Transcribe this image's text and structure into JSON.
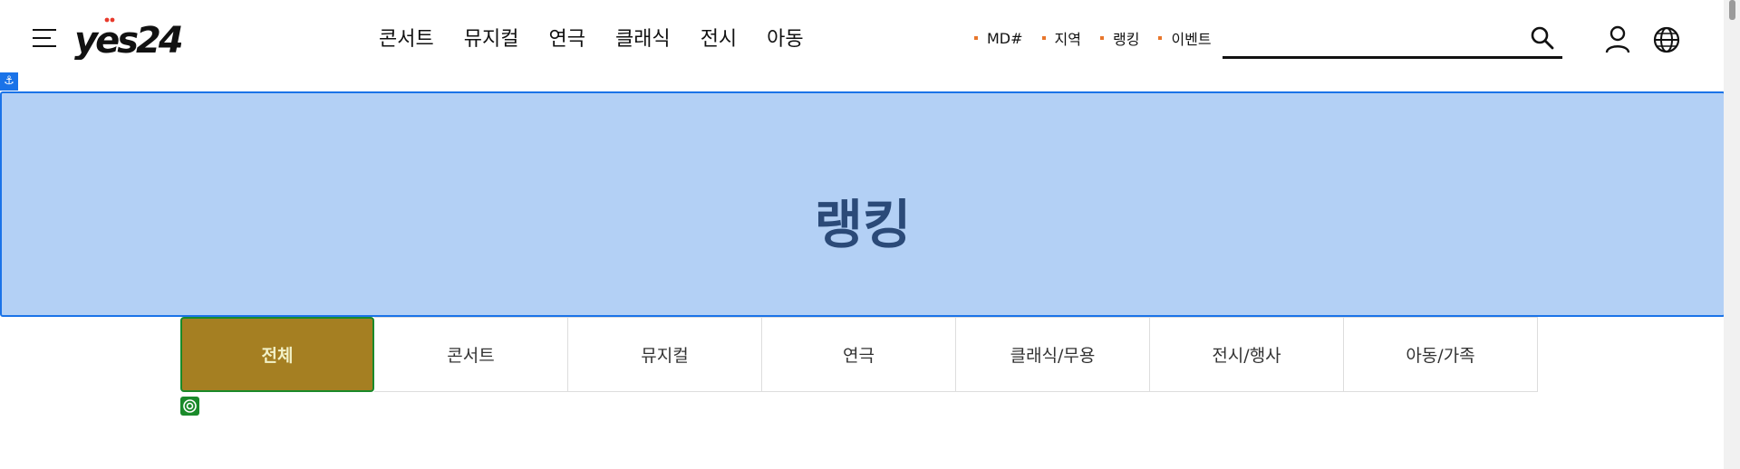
{
  "header": {
    "logo_text": "yes24",
    "nav": [
      "콘서트",
      "뮤지컬",
      "연극",
      "클래식",
      "전시",
      "아동"
    ],
    "quick_links": [
      "MD#",
      "지역",
      "랭킹",
      "이벤트"
    ],
    "search": {
      "placeholder": "",
      "value": ""
    }
  },
  "hero": {
    "title": "랭킹"
  },
  "tabs": [
    "전체",
    "콘서트",
    "뮤지컬",
    "연극",
    "클래식/무용",
    "전시/행사",
    "아동/가족"
  ],
  "active_tab": "전체",
  "colors": {
    "accent_dot": "#e8762b",
    "hero_bg": "#b3d0f5",
    "hero_title": "#2b4a78",
    "active_tab_bg": "#a57f22"
  }
}
